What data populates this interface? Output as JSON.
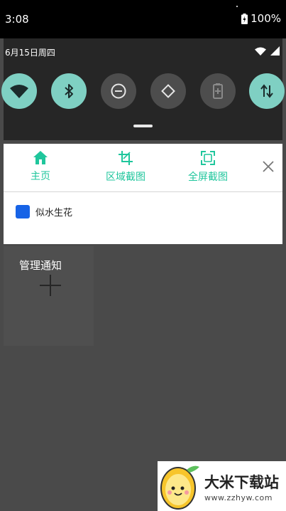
{
  "status_bar": {
    "time": "3:08",
    "battery": "100%"
  },
  "quick_settings": {
    "date": "6月15日周四",
    "tiles": [
      {
        "name": "wifi",
        "icon": "wifi-icon",
        "state": "on"
      },
      {
        "name": "bluetooth",
        "icon": "bluetooth-icon",
        "state": "on"
      },
      {
        "name": "do-not-disturb",
        "icon": "do-not-disturb-icon",
        "state": "off"
      },
      {
        "name": "auto-rotate",
        "icon": "auto-rotate-icon",
        "state": "off"
      },
      {
        "name": "battery-saver",
        "icon": "battery-saver-icon",
        "state": "off"
      },
      {
        "name": "mobile-data",
        "icon": "data-transfer-icon",
        "state": "on"
      }
    ]
  },
  "app_notification": {
    "actions": [
      {
        "label": "主页",
        "icon": "home-icon"
      },
      {
        "label": "区域截图",
        "icon": "crop-icon"
      },
      {
        "label": "全屏截图",
        "icon": "fullscreen-icon"
      }
    ],
    "close_icon": "close-icon",
    "item": {
      "text": "似水生花",
      "icon_color": "#1763e6"
    }
  },
  "manage": {
    "title": "管理通知",
    "add_icon": "plus-icon"
  },
  "watermark": {
    "title": "大米下载站",
    "url": "www.zzhyw.com"
  },
  "colors": {
    "accent": "#1fc69c",
    "tile_on": "#7fd0c3",
    "tile_off": "#4d4d4d"
  }
}
